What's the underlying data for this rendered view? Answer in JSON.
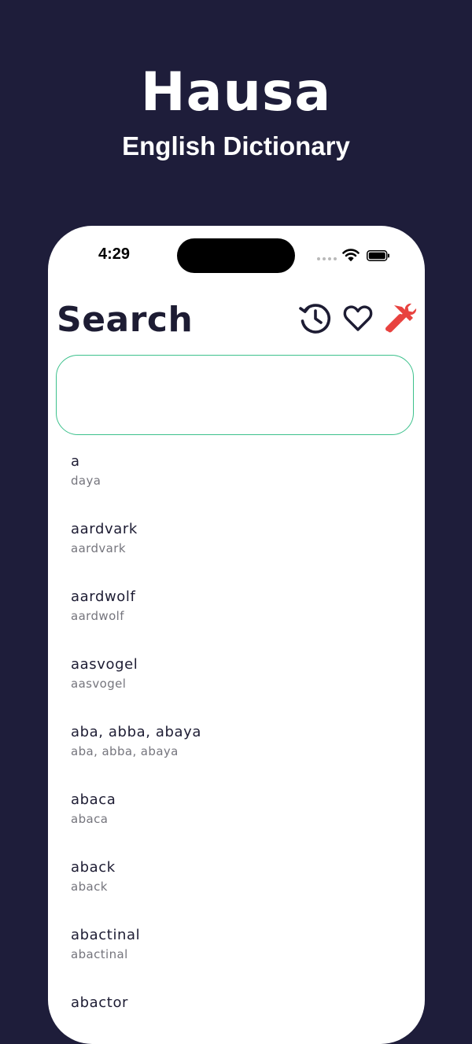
{
  "promo": {
    "title": "Hausa",
    "subtitle": "English Dictionary"
  },
  "status_bar": {
    "time": "4:29"
  },
  "header": {
    "title": "Search",
    "icons": {
      "history": "history-icon",
      "favorites": "heart-icon",
      "tools": "tools-icon"
    },
    "accent_color": "#e8423f",
    "dark_color": "#1d1c33"
  },
  "search": {
    "value": "",
    "placeholder": "",
    "border_color": "#3cc18c"
  },
  "results": [
    {
      "word": "a",
      "translation": "daya"
    },
    {
      "word": "aardvark",
      "translation": "aardvark"
    },
    {
      "word": "aardwolf",
      "translation": "aardwolf"
    },
    {
      "word": "aasvogel",
      "translation": "aasvogel"
    },
    {
      "word": "aba, abba, abaya",
      "translation": "aba, abba, abaya"
    },
    {
      "word": "abaca",
      "translation": "abaca"
    },
    {
      "word": "aback",
      "translation": "aback"
    },
    {
      "word": "abactinal",
      "translation": "abactinal"
    },
    {
      "word": "abactor",
      "translation": ""
    }
  ]
}
